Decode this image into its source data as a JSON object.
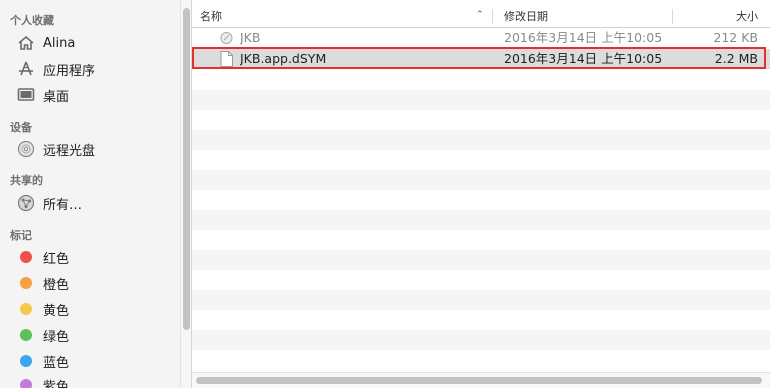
{
  "sidebar": {
    "favorites": {
      "heading": "个人收藏",
      "items": [
        {
          "label": "Alina",
          "icon": "home-icon"
        },
        {
          "label": "应用程序",
          "icon": "applications-icon"
        },
        {
          "label": "桌面",
          "icon": "desktop-icon"
        }
      ]
    },
    "devices": {
      "heading": "设备",
      "items": [
        {
          "label": "远程光盘",
          "icon": "disc-icon"
        }
      ]
    },
    "shared": {
      "heading": "共享的",
      "items": [
        {
          "label": "所有…",
          "icon": "network-globe-icon"
        }
      ]
    },
    "tags": {
      "heading": "标记",
      "items": [
        {
          "label": "红色",
          "color": "#f0504a"
        },
        {
          "label": "橙色",
          "color": "#f6a043"
        },
        {
          "label": "黄色",
          "color": "#f2c94c"
        },
        {
          "label": "绿色",
          "color": "#5dc05a"
        },
        {
          "label": "蓝色",
          "color": "#3aa7f0"
        },
        {
          "label": "紫色",
          "color": "#c27bd8"
        }
      ]
    }
  },
  "columns": {
    "name": "名称",
    "modified": "修改日期",
    "size": "大小"
  },
  "files": [
    {
      "name": "JKB",
      "modified": "2016年3月14日 上午10:05",
      "size": "212 KB",
      "icon": "app-icon"
    },
    {
      "name": "JKB.app.dSYM",
      "modified": "2016年3月14日 上午10:05",
      "size": "2.2 MB",
      "icon": "document-icon"
    }
  ],
  "colors": {
    "selection_outline": "#e0312a",
    "selected_row": "#dcdcdc"
  }
}
